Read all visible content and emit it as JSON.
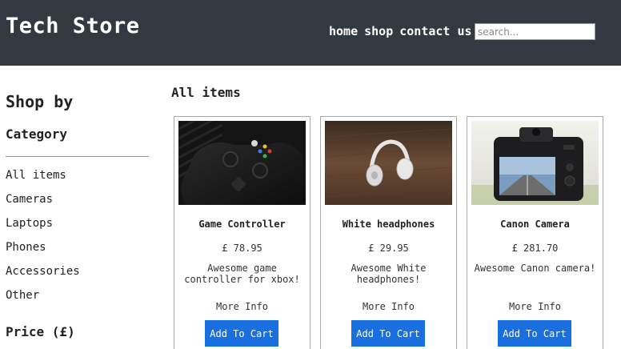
{
  "header": {
    "brand": "Tech Store",
    "nav": [
      "home",
      "shop",
      "contact us"
    ],
    "search_placeholder": "search..."
  },
  "sidebar": {
    "title": "Shop by",
    "category_heading": "Category",
    "categories": [
      "All items",
      "Cameras",
      "Laptops",
      "Phones",
      "Accessories",
      "Other"
    ],
    "price_heading": "Price (£)"
  },
  "main": {
    "title": "All items",
    "products": [
      {
        "name": "Game Controller",
        "price": "£ 78.95",
        "description": "Awesome game controller for xbox!",
        "more_info": "More Info",
        "cta": "Add To Cart",
        "image": "game-controller-photo"
      },
      {
        "name": "White headphones",
        "price": "£ 29.95",
        "description": "Awesome White headphones!",
        "more_info": "More Info",
        "cta": "Add To Cart",
        "image": "headphones-photo"
      },
      {
        "name": "Canon Camera",
        "price": "£ 281.70",
        "description": "Awesome Canon camera!",
        "more_info": "More Info",
        "cta": "Add To Cart",
        "image": "camera-photo"
      }
    ]
  },
  "colors": {
    "header_bg": "#333940",
    "button_bg": "#1a6fe0"
  }
}
